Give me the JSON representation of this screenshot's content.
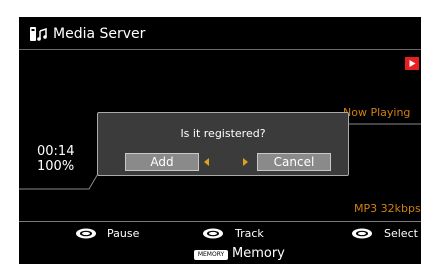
{
  "header": {
    "title": "Media Server",
    "icon": "media-server-icon"
  },
  "status": {
    "now_playing": "Now Playing",
    "elapsed": "00:14",
    "progress_percent": "100%",
    "bitrate": "MP3 32kbps",
    "play_indicator": "play-icon"
  },
  "dialog": {
    "question": "Is it registered?",
    "add_label": "Add",
    "cancel_label": "Cancel",
    "focused": "add"
  },
  "footer": {
    "pause_label": "Pause",
    "track_label": "Track",
    "select_label": "Select",
    "memory_badge": "MEMORY",
    "memory_label": "Memory"
  },
  "colors": {
    "accent": "#d08010",
    "arrow": "#e0a020",
    "button": "#8a8a8a",
    "dialog_bg": "#3b3b3b",
    "play_badge": "#e42020"
  }
}
